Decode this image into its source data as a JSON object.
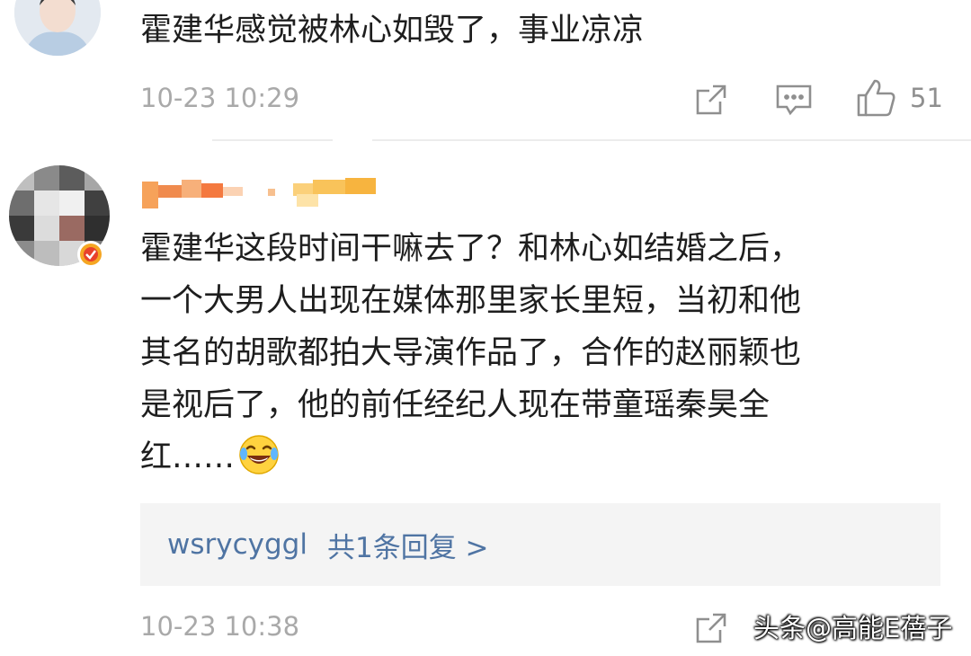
{
  "comments": [
    {
      "text": "霍建华感觉被林心如毁了，事业凉凉",
      "timestamp": "10-23 10:29",
      "like_count": "51",
      "icons": {
        "share": "share-icon",
        "comment": "comment-icon",
        "like": "thumbs-up-icon"
      }
    },
    {
      "lines": [
        "霍建华这段时间干嘛去了？和林心如结婚之后，",
        "一个大男人出现在媒体那里家长里短，当初和他",
        "其名的胡歌都拍大导演作品了，合作的赵丽颖也",
        "是视后了，他的前任经纪人现在带童瑶秦昊全",
        "红……"
      ],
      "emoji": "laughing-crying-emoji",
      "reply_user": "wsrycyggl",
      "reply_count_text": "共1条回复 >",
      "timestamp": "10-23 10:38",
      "icons": {
        "share": "share-icon",
        "badge": "verified-badge-icon"
      }
    }
  ],
  "watermark": "头条@高能E蓓子",
  "colors": {
    "meta_gray": "#a9a9a9",
    "link_blue": "#4f74a3",
    "reply_bg": "#f4f4f4",
    "badge_orange": "#f5a623",
    "badge_red": "#e8412c"
  }
}
